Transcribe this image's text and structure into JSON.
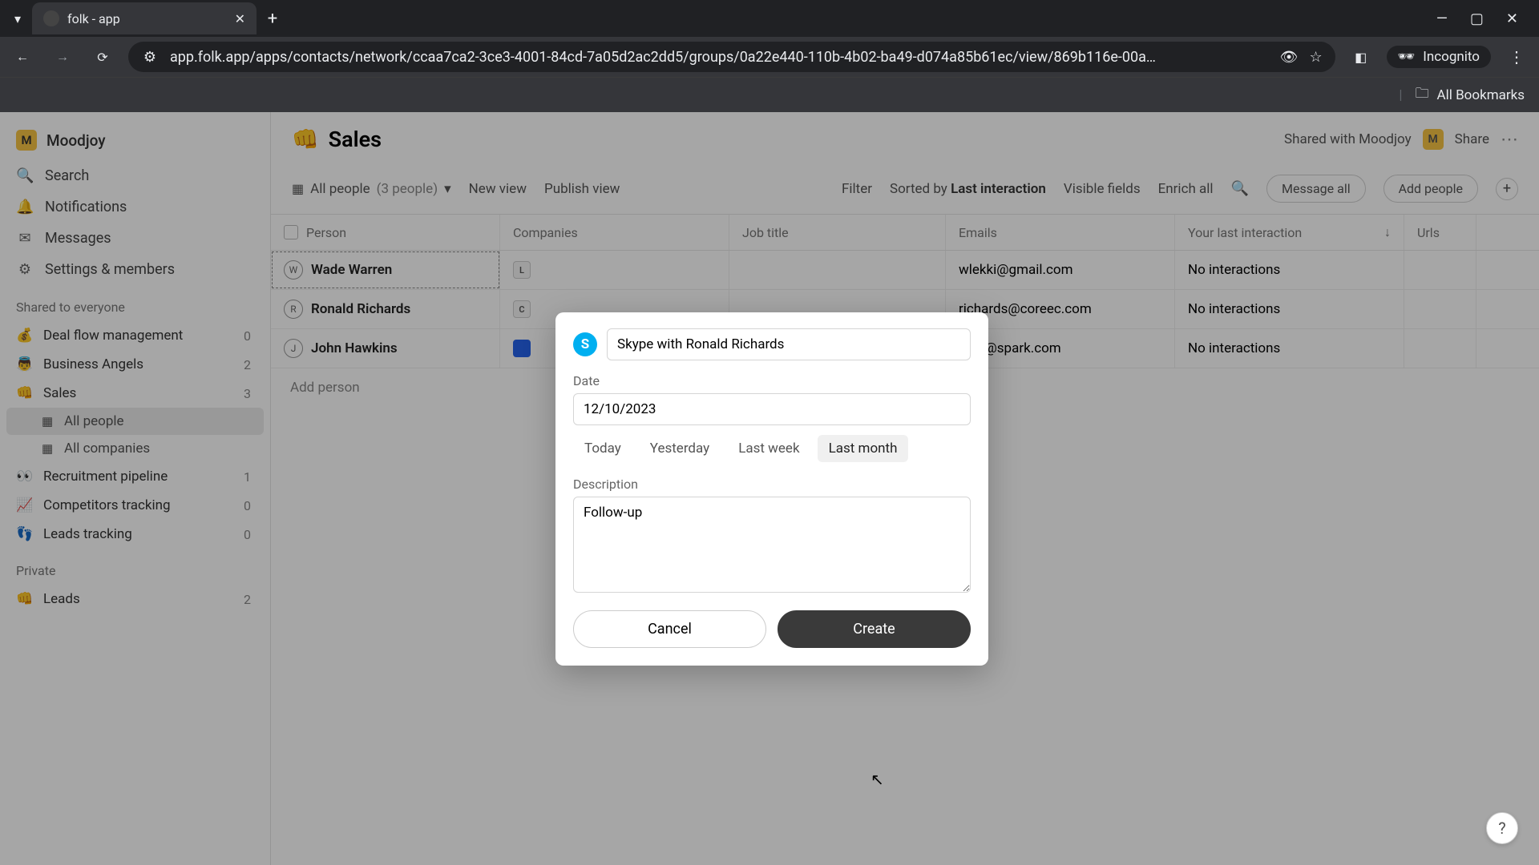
{
  "browser": {
    "tab_title": "folk - app",
    "url": "app.folk.app/apps/contacts/network/ccaa7ca2-3ce3-4001-84cd-7a05d2ac2dd5/groups/0a22e440-110b-4b02-ba49-d074a85b61ec/view/869b116e-00a…",
    "incognito_label": "Incognito",
    "all_bookmarks": "All Bookmarks"
  },
  "sidebar": {
    "workspace": "Moodjoy",
    "workspace_initial": "M",
    "nav": {
      "search": "Search",
      "notifications": "Notifications",
      "messages": "Messages",
      "settings": "Settings & members"
    },
    "shared_label": "Shared to everyone",
    "private_label": "Private",
    "shared_groups": [
      {
        "emoji": "💰",
        "name": "Deal flow management",
        "count": "0"
      },
      {
        "emoji": "👼",
        "name": "Business Angels",
        "count": "2"
      },
      {
        "emoji": "👊",
        "name": "Sales",
        "count": "3"
      },
      {
        "emoji": "👀",
        "name": "Recruitment pipeline",
        "count": "1"
      },
      {
        "emoji": "📈",
        "name": "Competitors tracking",
        "count": "0"
      },
      {
        "emoji": "👣",
        "name": "Leads tracking",
        "count": "0"
      }
    ],
    "sales_subs": [
      {
        "name": "All people",
        "active": true
      },
      {
        "name": "All companies",
        "active": false
      }
    ],
    "private_groups": [
      {
        "emoji": "👊",
        "name": "Leads",
        "count": "2"
      }
    ]
  },
  "main": {
    "emoji": "👊",
    "title": "Sales",
    "shared_with": "Shared with Moodjoy",
    "shared_initial": "M",
    "share_label": "Share"
  },
  "toolbar": {
    "view_label": "All people",
    "view_count": "(3 people)",
    "new_view": "New view",
    "publish_view": "Publish view",
    "filter": "Filter",
    "sorted_by_prefix": "Sorted by ",
    "sorted_by_field": "Last interaction",
    "visible_fields": "Visible fields",
    "enrich_all": "Enrich all",
    "message_all": "Message all",
    "add_people": "Add people"
  },
  "table": {
    "headers": {
      "person": "Person",
      "companies": "Companies",
      "job_title": "Job title",
      "emails": "Emails",
      "interaction": "Your last interaction",
      "urls": "Urls"
    },
    "rows": [
      {
        "initial": "W",
        "name": "Wade Warren",
        "company_badge": "L",
        "email": "wlekki@gmail.com",
        "interaction": "No interactions",
        "selected": true
      },
      {
        "initial": "R",
        "name": "Ronald Richards",
        "company_badge": "C",
        "email": "richards@coreec.com",
        "interaction": "No interactions",
        "selected": false
      },
      {
        "initial": "J",
        "name": "John Hawkins",
        "company_badge": "",
        "company_blue": true,
        "email": "john@spark.com",
        "interaction": "No interactions",
        "selected": false
      }
    ],
    "add_person": "Add person"
  },
  "modal": {
    "title_value": "Skype with Ronald Richards",
    "date_label": "Date",
    "date_value": "12/10/2023",
    "quick_dates": [
      "Today",
      "Yesterday",
      "Last week",
      "Last month"
    ],
    "quick_active_index": 3,
    "description_label": "Description",
    "description_value": "Follow-up",
    "cancel": "Cancel",
    "create": "Create"
  },
  "help": "?"
}
